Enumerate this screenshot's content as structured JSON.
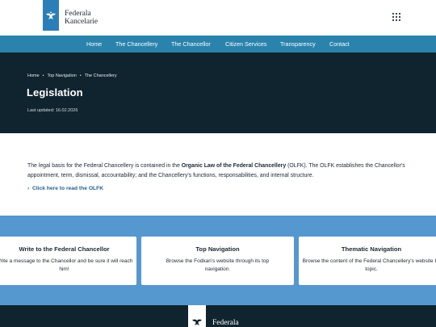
{
  "header": {
    "logo_line1": "Federala",
    "logo_line2": "Kancelarie",
    "logo_icon": "eagle-emblem-icon",
    "menu_icon": "apps-grid-icon"
  },
  "nav": {
    "items": [
      "Home",
      "The Chancellery",
      "The Chancellor",
      "Citizen Services",
      "Transparency",
      "Contact"
    ]
  },
  "hero": {
    "breadcrumb": [
      "Home",
      "Top Navigation",
      "The Chancellery"
    ],
    "breadcrumb_separator": "•",
    "title": "Legislation",
    "updated": "Last updated: 16.02.2026"
  },
  "content": {
    "p_before": "The legal basis for the Federal Chancellery is contained in the ",
    "p_bold": "Organic Law of the Federal Chancellery",
    "p_after": " (OLFK). The OLFK establishes the Chancellor's appointment, term, dismissal, accountability; and the Chancellery's functions, responsabilities, and internal structure.",
    "link_arrow": "›",
    "link_label": "Click here to read the OLFK"
  },
  "cards": [
    {
      "title": "Write to the Federal Chancellor",
      "desc": "Write a message to the Chancellor and be sure it will reach him!"
    },
    {
      "title": "Top Navigation",
      "desc": "Browse the Fodkan's website through its top navigation."
    },
    {
      "title": "Thematic Navigation",
      "desc": "Browse the content of the Federal Chancellery's website by topic."
    }
  ],
  "footer": {
    "logo_text": "Federala"
  },
  "colors": {
    "nav_bg": "#2a83ad",
    "hero_bg": "#10242f",
    "band_bg": "#5598cf",
    "brand_blue": "#2b7fb8",
    "link": "#1f5f8b"
  }
}
